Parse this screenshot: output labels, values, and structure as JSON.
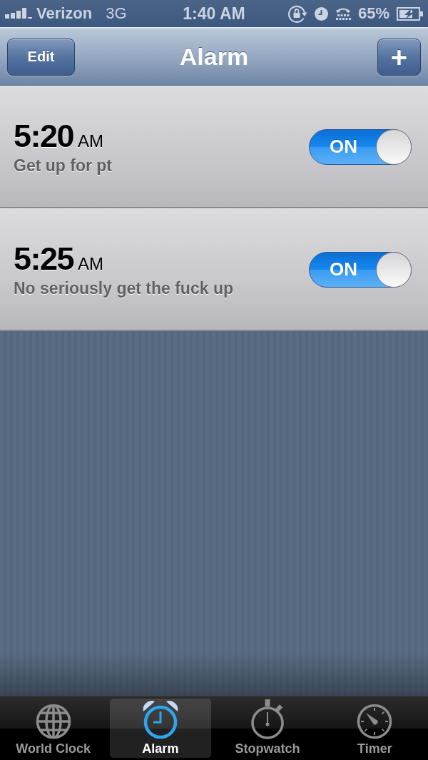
{
  "status_bar": {
    "carrier": "Verizon",
    "network": "3G",
    "time": "1:40 AM",
    "battery": "65%"
  },
  "nav_bar": {
    "left_button": "Edit",
    "title": "Alarm",
    "right_button": "+"
  },
  "alarms": [
    {
      "time": "5:20",
      "period": "AM",
      "label": "Get up for pt",
      "on": true,
      "toggle_text": "ON"
    },
    {
      "time": "5:25",
      "period": "AM",
      "label": "No seriously get the fuck up",
      "on": true,
      "toggle_text": "ON"
    }
  ],
  "tab_bar": {
    "tabs": [
      {
        "label": "World Clock",
        "selected": false
      },
      {
        "label": "Alarm",
        "selected": true
      },
      {
        "label": "Stopwatch",
        "selected": false
      },
      {
        "label": "Timer",
        "selected": false
      }
    ]
  }
}
